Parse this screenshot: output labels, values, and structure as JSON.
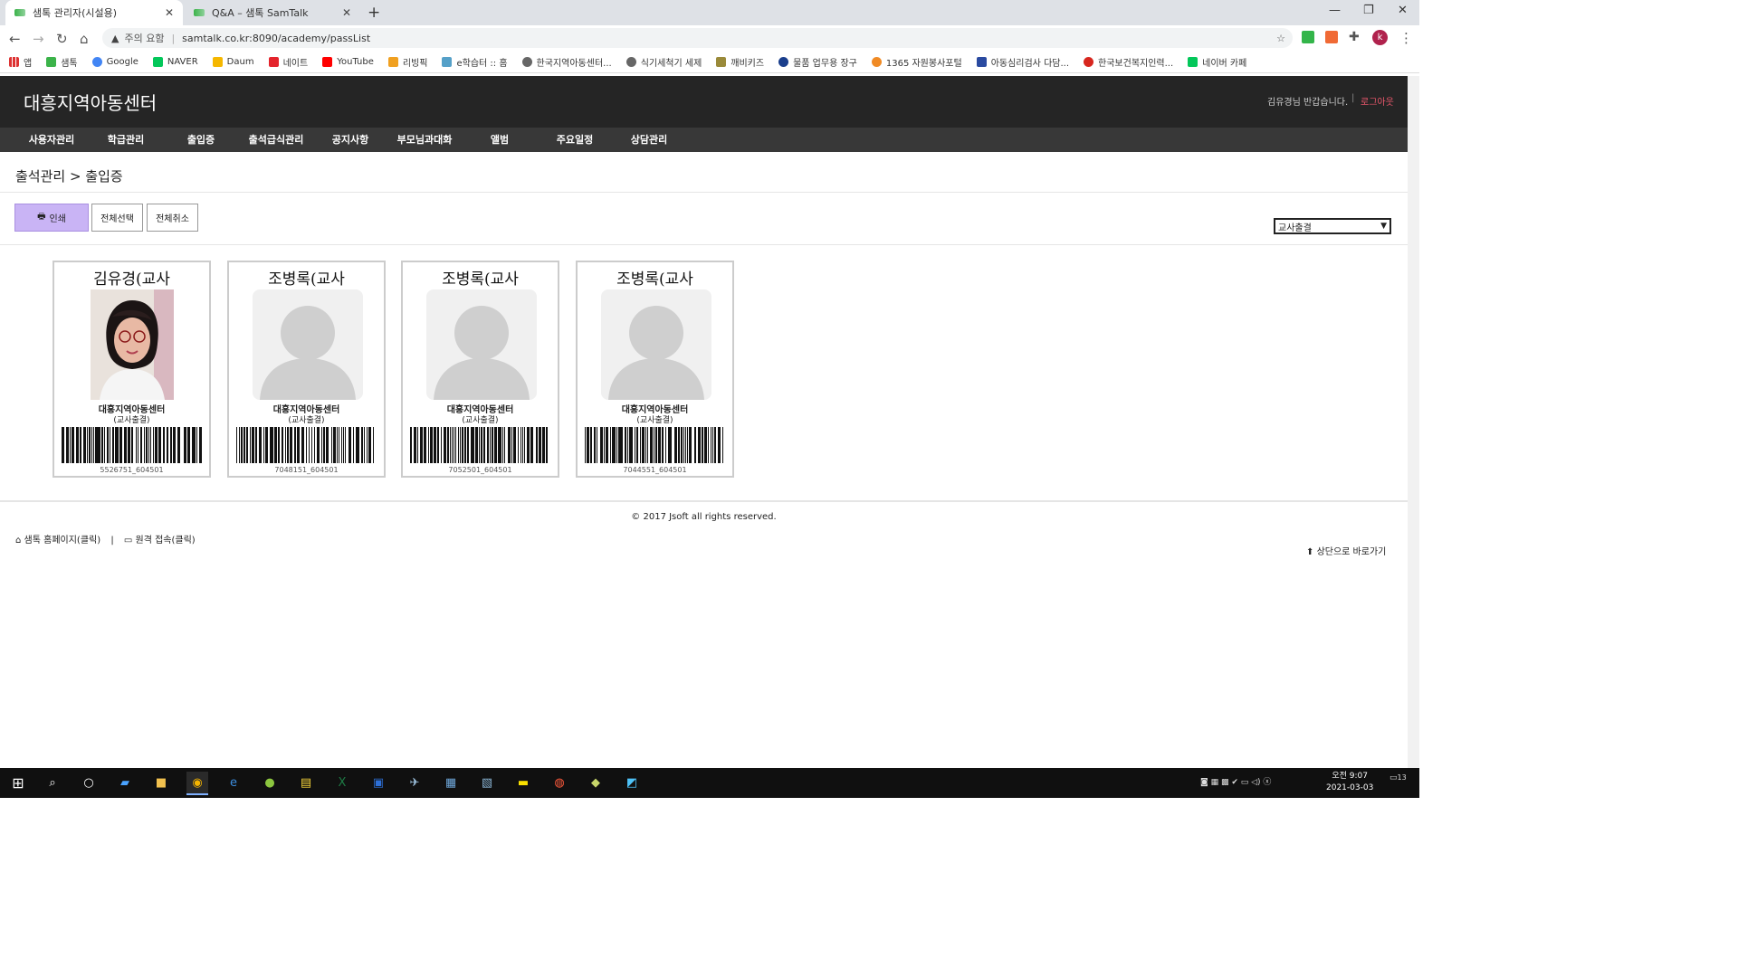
{
  "browser": {
    "tabs": [
      {
        "title": "샘톡 관리자(시설용)",
        "active": true
      },
      {
        "title": "Q&A – 샘톡 SamTalk",
        "active": false
      }
    ],
    "address": {
      "security_label": "주의 요함",
      "url": "samtalk.co.kr:8090/academy/passList"
    },
    "profile_initial": "k",
    "bookmarks": [
      "앱",
      "샘톡",
      "Google",
      "NAVER",
      "Daum",
      "네이트",
      "YouTube",
      "리빙픽",
      "e학습터 :: 홈",
      "한국지역아동센터...",
      "식기세척기 세제",
      "깨비키즈",
      "물품 업무용 장구",
      "1365 자원봉사포털",
      "아동심리검사 다담...",
      "한국보건복지인력...",
      "네이버 카페"
    ]
  },
  "site": {
    "title": "대흥지역아동센터",
    "welcome": "김유경님 반갑습니다.",
    "logout": "로그아웃",
    "menu": [
      "사용자관리",
      "학급관리",
      "출입증",
      "출석급식관리",
      "공지사항",
      "부모님과대화",
      "앨범",
      "주요일정",
      "상담관리"
    ],
    "breadcrumb": "출석관리 > 출입증",
    "buttons": {
      "print": "인쇄",
      "select_all": "전체선택",
      "deselect_all": "전체취소"
    },
    "filter": {
      "selected": "교사출결"
    },
    "cards": [
      {
        "name": "김유경(교사",
        "org": "대흥지역아동센터",
        "role": "(교사출결)",
        "code": "5526751_604501",
        "photo": "person-photo"
      },
      {
        "name": "조병록(교사",
        "org": "대흥지역아동센터",
        "role": "(교사출결)",
        "code": "7048151_604501",
        "photo": "placeholder"
      },
      {
        "name": "조병록(교사",
        "org": "대흥지역아동센터",
        "role": "(교사출결)",
        "code": "7052501_604501",
        "photo": "placeholder"
      },
      {
        "name": "조병록(교사",
        "org": "대흥지역아동센터",
        "role": "(교사출결)",
        "code": "7044551_604501",
        "photo": "placeholder"
      }
    ],
    "footer": {
      "copyright": "© 2017 Jsoft all rights reserved.",
      "homepage_link": "샘톡 홈페이지(클릭)",
      "remote_link": "원격 접속(클릭)",
      "to_top": "상단으로 바로가기"
    }
  },
  "taskbar": {
    "clock_time": "오전 9:07",
    "clock_date": "2021-03-03",
    "notification_count": "13"
  }
}
